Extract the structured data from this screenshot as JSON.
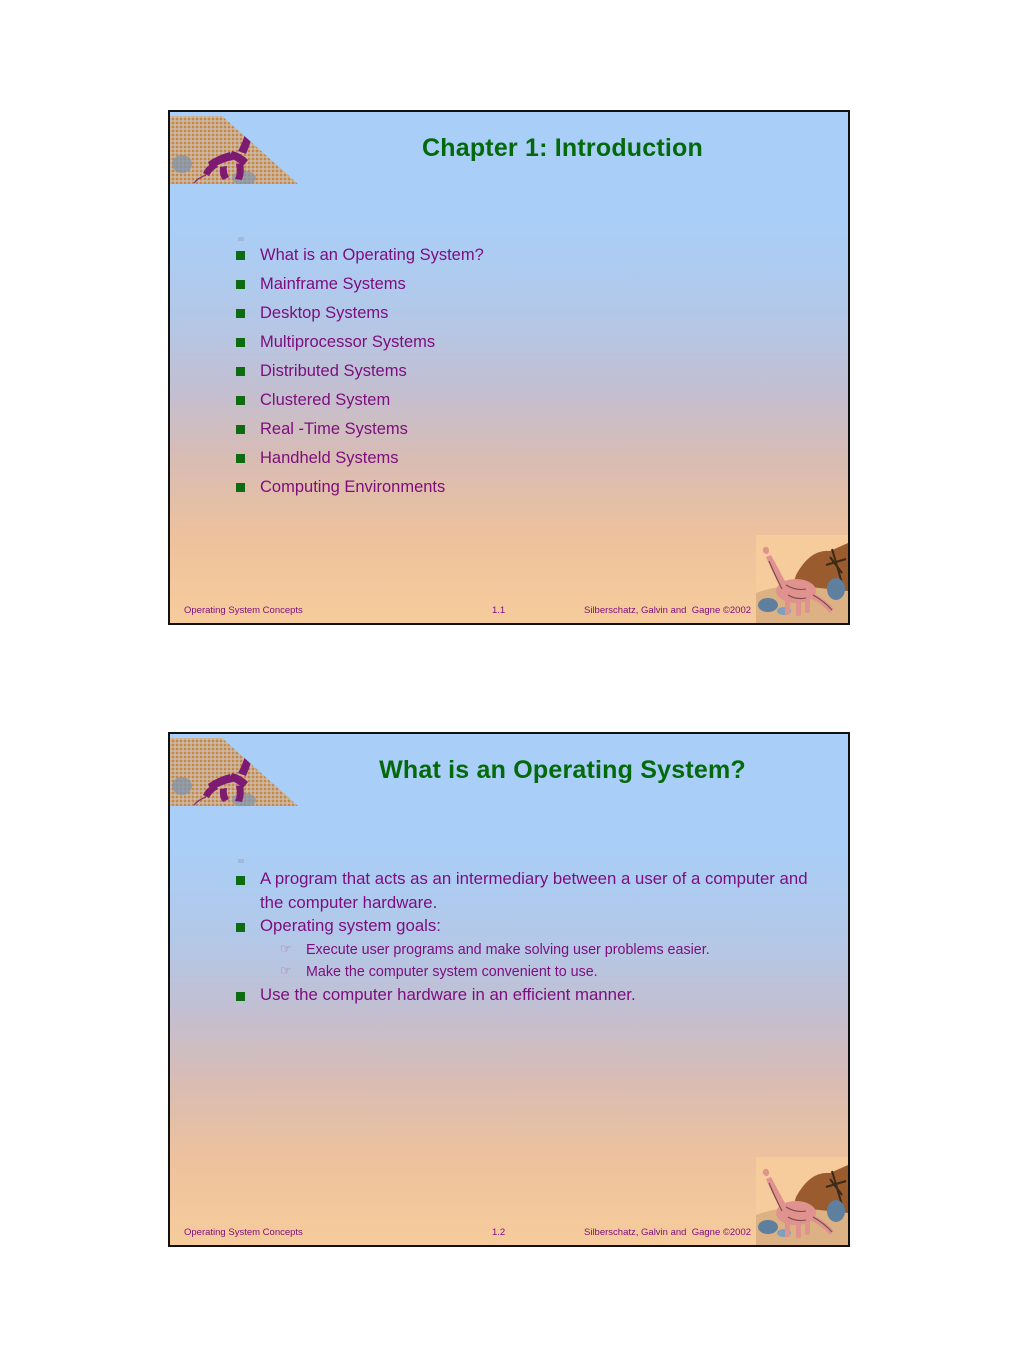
{
  "document": {
    "background_color": "#ffffff",
    "slide_count": 2
  },
  "theme": {
    "title_color": "#04690a",
    "body_text_color": "#7d0d7d",
    "bullet_square_color": "#0e6b11",
    "subbullet_color": "#a96fb0",
    "gradient_top": "#a9cef7",
    "gradient_bottom": "#f6cc9c",
    "border_color": "#111111",
    "bullet_icon": "green-square",
    "subbullet_icon": "pointing-hand",
    "subbullet_glyph": "☞"
  },
  "slides": [
    {
      "title": "Chapter 1:   Introduction",
      "bullets": [
        {
          "level": 1,
          "text": "What is an Operating System?"
        },
        {
          "level": 1,
          "text": "Mainframe Systems"
        },
        {
          "level": 1,
          "text": "Desktop Systems"
        },
        {
          "level": 1,
          "text": "Multiprocessor Systems"
        },
        {
          "level": 1,
          "text": "Distributed Systems"
        },
        {
          "level": 1,
          "text": "Clustered System"
        },
        {
          "level": 1,
          "text": "Real -Time Systems"
        },
        {
          "level": 1,
          "text": "Handheld Systems"
        },
        {
          "level": 1,
          "text": "Computing Environments"
        }
      ],
      "footer": {
        "left": "Operating System Concepts",
        "center": "1.1",
        "right": "Silberschatz, Galvin and  Gagne ©2002"
      }
    },
    {
      "title": "What is an Operating System?",
      "bullets": [
        {
          "level": 1,
          "text": "A program that acts as an intermediary between a user of a computer and the computer hardware."
        },
        {
          "level": 1,
          "text": "Operating system goals:"
        },
        {
          "level": 2,
          "text": "Execute user programs and make solving user problems easier."
        },
        {
          "level": 2,
          "text": "Make the computer system convenient to use."
        },
        {
          "level": 1,
          "text": "Use the computer hardware in an efficient manner."
        }
      ],
      "footer": {
        "left": "Operating System Concepts",
        "center": "1.2",
        "right": "Silberschatz, Galvin and  Gagne ©2002"
      }
    }
  ],
  "artwork": {
    "top_left": "purple-tyrannosaur-on-sand-slope",
    "bottom_right": "pink-sauropod-with-brown-hill"
  }
}
